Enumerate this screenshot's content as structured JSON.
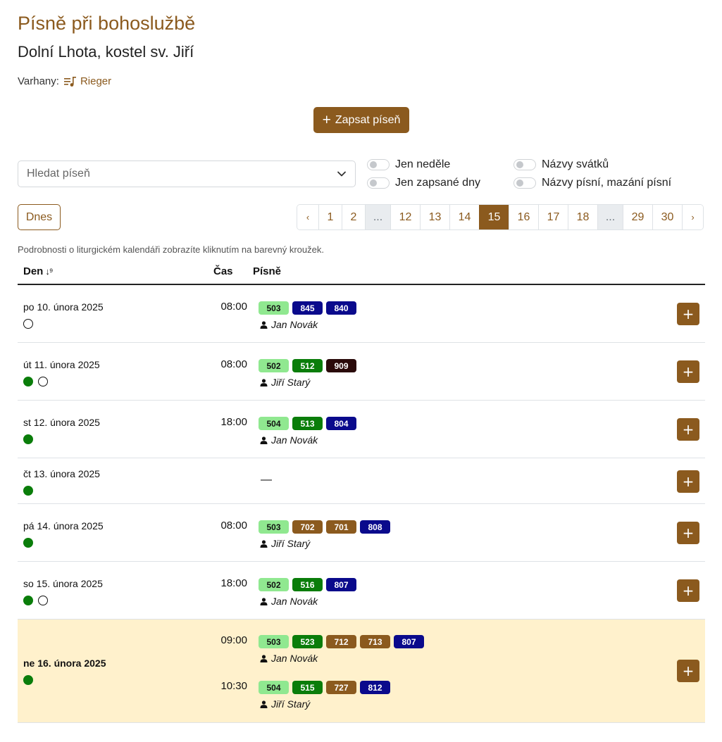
{
  "page": {
    "title": "Písně při bohoslužbě",
    "subtitle": "Dolní Lhota, kostel sv. Jiří",
    "organ_label": "Varhany:",
    "organ_name": "Rieger"
  },
  "actions": {
    "add_song_label": "Zapsat píseň"
  },
  "filters": {
    "search_placeholder": "Hledat píseň",
    "toggle_sundays": "Jen neděle",
    "toggle_recorded_days": "Jen zapsané dny",
    "toggle_feast_names": "Názvy svátků",
    "toggle_song_names": "Názvy písní, mazání písní"
  },
  "nav": {
    "today_label": "Dnes",
    "pages": [
      "‹",
      "1",
      "2",
      "...",
      "12",
      "13",
      "14",
      "15",
      "16",
      "17",
      "18",
      "...",
      "29",
      "30",
      "›"
    ],
    "active_page": "15"
  },
  "hint": "Podrobnosti o liturgickém kalendáři zobrazíte kliknutím na barevný kroužek.",
  "table": {
    "headers": {
      "day": "Den",
      "time": "Čas",
      "songs": "Písně"
    },
    "rows": [
      {
        "date": "po 10. února 2025",
        "dots": [
          "white"
        ],
        "services": [
          {
            "time": "08:00",
            "songs": [
              {
                "n": "503",
                "c": "lightgreen"
              },
              {
                "n": "845",
                "c": "navy"
              },
              {
                "n": "840",
                "c": "navy"
              }
            ],
            "person": "Jan Novák"
          }
        ]
      },
      {
        "date": "út 11. února 2025",
        "dots": [
          "green",
          "white"
        ],
        "services": [
          {
            "time": "08:00",
            "songs": [
              {
                "n": "502",
                "c": "lightgreen"
              },
              {
                "n": "512",
                "c": "green"
              },
              {
                "n": "909",
                "c": "black"
              }
            ],
            "person": "Jiří Starý"
          }
        ]
      },
      {
        "date": "st 12. února 2025",
        "dots": [
          "green"
        ],
        "services": [
          {
            "time": "18:00",
            "songs": [
              {
                "n": "504",
                "c": "lightgreen"
              },
              {
                "n": "513",
                "c": "green"
              },
              {
                "n": "804",
                "c": "navy"
              }
            ],
            "person": "Jan Novák"
          }
        ]
      },
      {
        "date": "čt 13. února 2025",
        "dots": [
          "green"
        ],
        "services": [],
        "empty": "—"
      },
      {
        "date": "pá 14. února 2025",
        "dots": [
          "green"
        ],
        "services": [
          {
            "time": "08:00",
            "songs": [
              {
                "n": "503",
                "c": "lightgreen"
              },
              {
                "n": "702",
                "c": "brown"
              },
              {
                "n": "701",
                "c": "brown"
              },
              {
                "n": "808",
                "c": "navy"
              }
            ],
            "person": "Jiří Starý"
          }
        ]
      },
      {
        "date": "so 15. února 2025",
        "dots": [
          "green",
          "white"
        ],
        "services": [
          {
            "time": "18:00",
            "songs": [
              {
                "n": "502",
                "c": "lightgreen"
              },
              {
                "n": "516",
                "c": "green"
              },
              {
                "n": "807",
                "c": "navy"
              }
            ],
            "person": "Jan Novák"
          }
        ]
      },
      {
        "date": "ne 16. února 2025",
        "dots": [
          "green"
        ],
        "today": true,
        "services": [
          {
            "time": "09:00",
            "songs": [
              {
                "n": "503",
                "c": "lightgreen"
              },
              {
                "n": "523",
                "c": "green"
              },
              {
                "n": "712",
                "c": "brown"
              },
              {
                "n": "713",
                "c": "brown"
              },
              {
                "n": "807",
                "c": "navy"
              }
            ],
            "person": "Jan Novák"
          },
          {
            "time": "10:30",
            "songs": [
              {
                "n": "504",
                "c": "lightgreen"
              },
              {
                "n": "515",
                "c": "green"
              },
              {
                "n": "727",
                "c": "brown"
              },
              {
                "n": "812",
                "c": "navy"
              }
            ],
            "person": "Jiří Starý"
          }
        ]
      }
    ]
  },
  "colors": {
    "accent": "#8b5a1e",
    "song_lightgreen": "#90e890",
    "song_green": "#0a7d0a",
    "song_navy": "#0a0a8c",
    "song_brown": "#8b5a1e",
    "song_black": "#2a0a0a",
    "today_highlight": "#fff1cc"
  }
}
